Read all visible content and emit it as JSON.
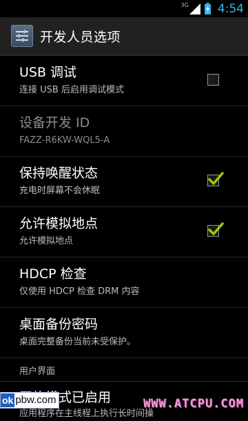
{
  "statusbar": {
    "network": "3G",
    "time": "4:54"
  },
  "actionbar": {
    "title": "开发人员选项"
  },
  "items": [
    {
      "title": "USB 调试",
      "subtitle": "连接 USB 后启用调试模式",
      "checked": false
    },
    {
      "title": "设备开发 ID",
      "subtitle": "FAZZ-R6KW-WQL5-A",
      "disabled": true
    },
    {
      "title": "保持唤醒状态",
      "subtitle": "充电时屏幕不会休眠",
      "checked": true
    },
    {
      "title": "允许模拟地点",
      "subtitle": "允许模拟地点",
      "checked": true
    },
    {
      "title": "HDCP 检查",
      "subtitle": "仅使用 HDCP 检查 DRM 内容"
    },
    {
      "title": "桌面备份密码",
      "subtitle": "桌面完整备份当前未受保护。"
    }
  ],
  "category": "用户界面",
  "partial_item": {
    "title": "严格模式已启用",
    "subtitle": "应用程序在主线程上执行长时间操"
  },
  "watermarks": {
    "left_ok": "ok",
    "left_rest": "pbw.com",
    "right": "WWW.ATCPU.COM"
  },
  "colors": {
    "accent": "#33b5e5",
    "check": "#99cc00",
    "background": "#000000",
    "actionbar": "#212121"
  }
}
